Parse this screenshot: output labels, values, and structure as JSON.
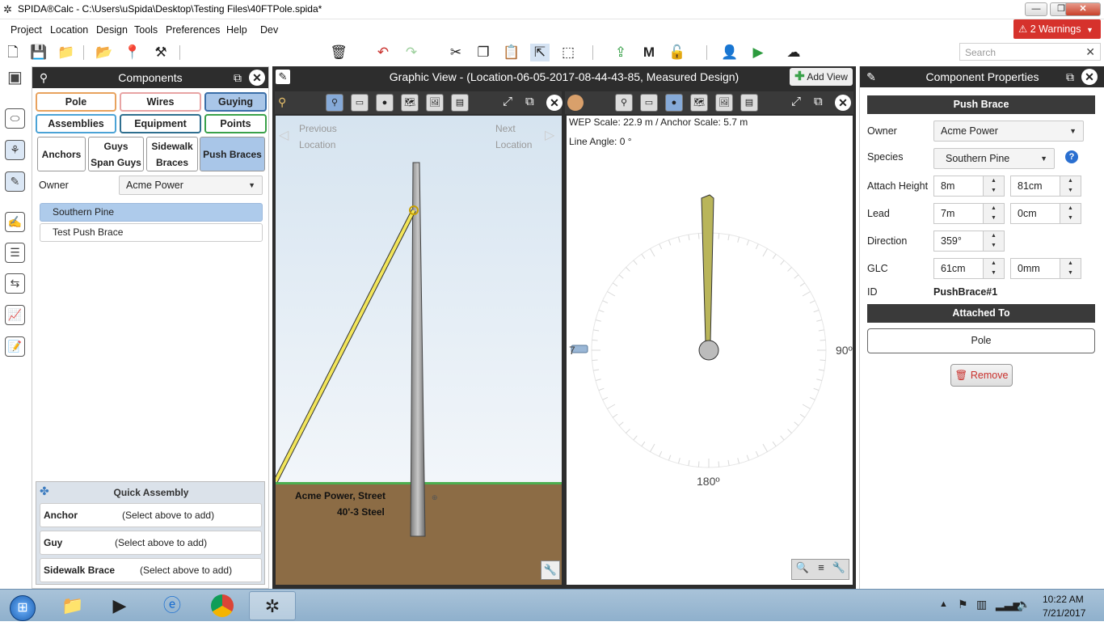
{
  "window": {
    "title": "SPIDA®Calc - C:\\Users\\uSpida\\Desktop\\Testing Files\\40FTPole.spida*"
  },
  "menu": [
    "Project",
    "Location",
    "Design",
    "Tools",
    "Preferences",
    "Help",
    "Dev"
  ],
  "warnings": {
    "label": "2 Warnings"
  },
  "search": {
    "placeholder": "Search"
  },
  "components": {
    "title": "Components",
    "categories": [
      "Pole",
      "Wires",
      "Guying",
      "Assemblies",
      "Equipment",
      "Points"
    ],
    "tabs": [
      "Anchors",
      "Guys\nSpan Guys",
      "Sidewalk\nBraces",
      "Push Braces"
    ],
    "owner_label": "Owner",
    "owner_value": "Acme Power",
    "items": [
      "Southern Pine",
      "Test Push Brace"
    ],
    "quick_assembly": {
      "title": "Quick Assembly",
      "rows": [
        {
          "label": "Anchor",
          "hint": "(Select above to add)"
        },
        {
          "label": "Guy",
          "hint": "(Select above to add)"
        },
        {
          "label": "Sidewalk Brace",
          "hint": "(Select above to add)"
        }
      ]
    }
  },
  "graphic": {
    "title": "Graphic View - (Location-06-05-2017-08-44-43-85, Measured Design)",
    "add_view": "Add View",
    "prev": "Previous\nLocation",
    "next": "Next\nLocation",
    "pole_label_1": "Acme Power, Street",
    "pole_label_2": "40'-3 Steel",
    "wep_scale": "WEP Scale: 22.9 m / Anchor Scale: 5.7 m",
    "line_angle": "Line Angle: 0 °",
    "angle_90": "90º",
    "angle_180": "180º",
    "angle_270": "7"
  },
  "properties": {
    "title": "Component Properties",
    "section": "Push Brace",
    "owner_label": "Owner",
    "owner_value": "Acme Power",
    "species_label": "Species",
    "species_value": "Southern Pine",
    "attach_label": "Attach Height",
    "attach_m": "8m",
    "attach_cm": "81cm",
    "lead_label": "Lead",
    "lead_m": "7m",
    "lead_cm": "0cm",
    "direction_label": "Direction",
    "direction_value": "359°",
    "glc_label": "GLC",
    "glc_cm": "61cm",
    "glc_mm": "0mm",
    "id_label": "ID",
    "id_value": "PushBrace#1",
    "attached_header": "Attached To",
    "attached_value": "Pole",
    "remove": "Remove"
  },
  "taskbar": {
    "time": "10:22 AM",
    "date": "7/21/2017"
  },
  "colors": {
    "accent_blue": "#86aad8",
    "warning_red": "#d6322c",
    "ground": "#8c6c45",
    "brace_yellow": "#f2e55a"
  }
}
